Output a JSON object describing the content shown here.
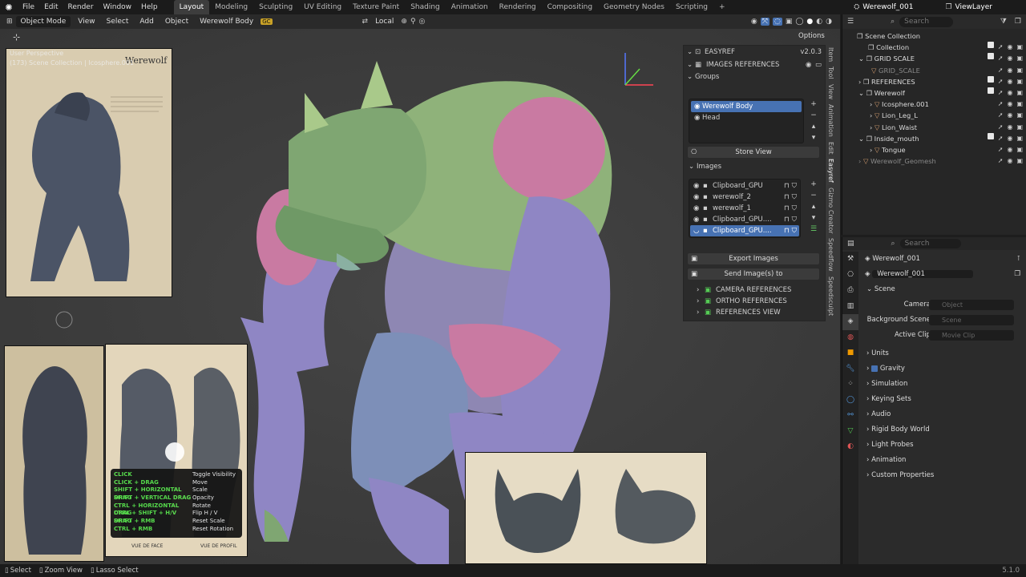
{
  "topbar": {
    "menus": [
      "File",
      "Edit",
      "Render",
      "Window",
      "Help"
    ],
    "workspaces": [
      "Layout",
      "Modeling",
      "Sculpting",
      "UV Editing",
      "Texture Paint",
      "Shading",
      "Animation",
      "Rendering",
      "Compositing",
      "Geometry Nodes",
      "Scripting"
    ],
    "add_tab": "+",
    "scene_name": "Werewolf_001",
    "view_layer": "ViewLayer"
  },
  "viewport_header": {
    "mode": "Object Mode",
    "menus": [
      "View",
      "Select",
      "Add",
      "Object"
    ],
    "active_object": "Werewolf Body",
    "transform_orientation": "Local",
    "options": "Options"
  },
  "viewport": {
    "perspective_label": "User Perspective",
    "collection_label": "(173) Scene Collection | Icosphere.001",
    "key_help": [
      {
        "key": "CLICK",
        "action": "Toggle Visibility"
      },
      {
        "key": "CLICK + DRAG",
        "action": "Move"
      },
      {
        "key": "SHIFT + HORIZONTAL DRAG",
        "action": "Scale"
      },
      {
        "key": "SHIFT + VERTICAL DRAG",
        "action": "Opacity"
      },
      {
        "key": "CTRL + HORIZONTAL DRAG",
        "action": "Rotate"
      },
      {
        "key": "CTRL + SHIFT + H/V DRAG",
        "action": "Flip H / V"
      },
      {
        "key": "SHIFT + RMB",
        "action": "Reset Scale"
      },
      {
        "key": "CTRL + RMB",
        "action": "Reset Rotation"
      }
    ],
    "ref_title": "Werewolf",
    "ref_caption_face": "VUE DE FACE",
    "ref_caption_profile": "VUE DE PROFIL"
  },
  "sidebar_tabs": [
    "Item",
    "Tool",
    "View",
    "Animation",
    "Edit",
    "Easyref",
    "Gizmo Creator",
    "Speedflow",
    "Speedsculpt"
  ],
  "easyref": {
    "title": "EASYREF",
    "version": "v2.0.3",
    "images_references": "IMAGES REFERENCES",
    "groups_label": "Groups",
    "groups": [
      "Werewolf Body",
      "Head"
    ],
    "store_view": "Store View",
    "images_label": "Images",
    "images": [
      "Clipboard_GPU",
      "werewolf_2",
      "werewolf_1",
      "Clipboard_GPU....",
      "Clipboard_GPU...."
    ],
    "export_images": "Export Images",
    "send_images": "Send Image(s) to",
    "sections": [
      "CAMERA REFERENCES",
      "ORTHO REFERENCES",
      "REFERENCES VIEW"
    ]
  },
  "outliner": {
    "search_placeholder": "Search",
    "root": "Scene Collection",
    "items": [
      "Collection",
      "GRID SCALE",
      "GRID_SCALE",
      "REFERENCES",
      "Werewolf",
      "Icosphere.001",
      "Lion_Leg_L",
      "Lion_Waist",
      "Inside_mouth",
      "Tongue",
      "Werewolf_Geomesh"
    ]
  },
  "properties": {
    "search_placeholder": "Search",
    "scene_label": "Werewolf_001",
    "scene_field": "Werewolf_001",
    "scene_panel": "Scene",
    "camera_label": "Camera",
    "camera_placeholder": "Object",
    "bg_scene_label": "Background Scene",
    "bg_scene_placeholder": "Scene",
    "active_clip_label": "Active Clip",
    "active_clip_placeholder": "Movie Clip",
    "panels": [
      "Units",
      "Gravity",
      "Simulation",
      "Keying Sets",
      "Audio",
      "Rigid Body World",
      "Light Probes",
      "Animation",
      "Custom Properties"
    ]
  },
  "statusbar": {
    "select": "Select",
    "zoom": "Zoom View",
    "lasso": "Lasso Select",
    "version": "5.1.0"
  }
}
